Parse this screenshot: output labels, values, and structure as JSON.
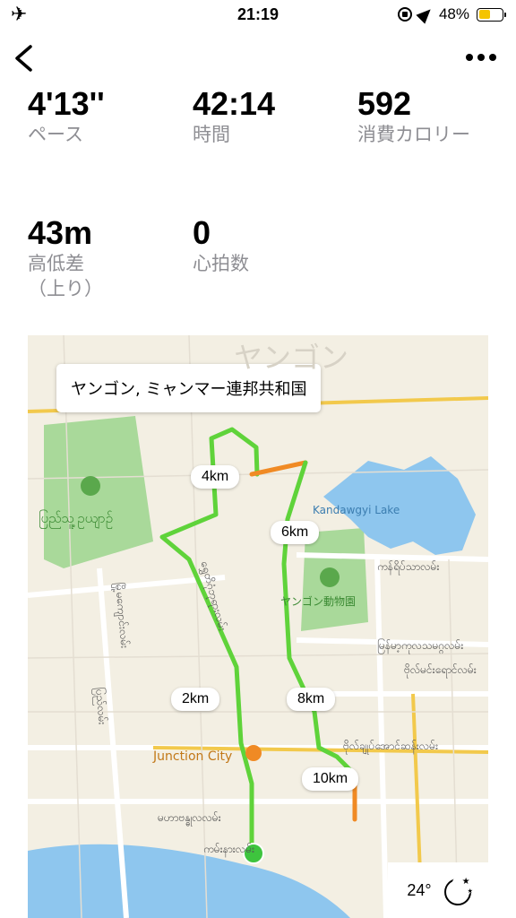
{
  "status_bar": {
    "time": "21:19",
    "battery": "48%",
    "battery_level": 0.48,
    "icons": [
      "airplane-icon",
      "rotation-lock-icon",
      "location-arrow-icon",
      "battery-icon"
    ]
  },
  "nav": {
    "back_icon": "chevron-left-icon",
    "more_icon": "ellipsis-icon"
  },
  "stats": [
    {
      "value": "4'13''",
      "label": "ペース"
    },
    {
      "value": "42:14",
      "label": "時間"
    },
    {
      "value": "592",
      "label": "消費カロリー"
    },
    {
      "value": "43m",
      "label": "高低差（上り）"
    },
    {
      "value": "0",
      "label": "心拍数"
    }
  ],
  "map": {
    "location": "ヤンゴン, ミャンマー連邦共和国",
    "park_label": "ပြည်သူ့ဥယျာဉ်",
    "lake_label": "Kandawgyi Lake",
    "lake_road": "ကန်ရိပ်သာလမ်း",
    "zoo_label": "ヤンゴン動物園",
    "junction_label": "Junction City",
    "top_label": "ヤンゴン",
    "streets": [
      "ရွှေတိဂုံဘုရားလမ်း",
      "မြို့မကျောင်းလမ်း",
      "ပြည်လမ်း",
      "မဟာဗန္ဓုလလမ်း",
      "ဗိုလ်ချုပ်အောင်ဆန်းလမ်း",
      "မြန်မာ့ကုလသမဂ္ဂလမ်း",
      "ဗိုလ်မင်းရောင်လမ်း",
      "ကမ်းနားလမ်း"
    ],
    "km_markers": [
      "2km",
      "4km",
      "6km",
      "8km",
      "10km"
    ],
    "start_color": "#3ec43e",
    "end_color": "#e01010",
    "route_color": "#5fd33a"
  },
  "weather": {
    "temperature": "24°",
    "icon": "moon-stars-icon"
  }
}
